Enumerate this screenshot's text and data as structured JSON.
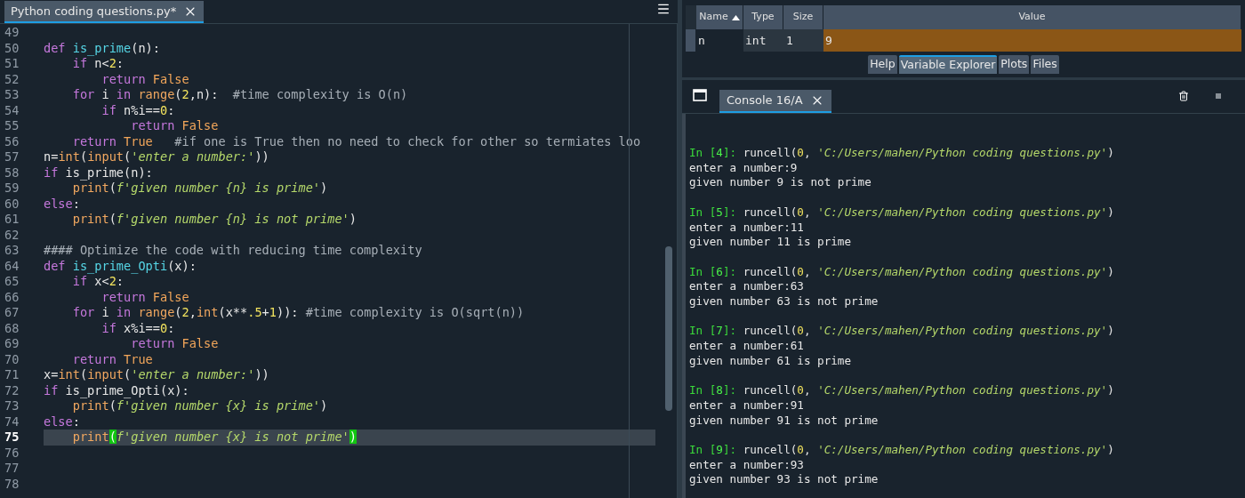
{
  "editor": {
    "tab": {
      "title": "Python coding questions.py*",
      "selected": true
    },
    "lines": [
      {
        "number": "49",
        "current": false
      },
      {
        "number": "50",
        "current": false,
        "tokens": [
          {
            "kind": "kw",
            "text": "def "
          },
          {
            "kind": "fn",
            "text": "is_prime"
          },
          {
            "kind": "txt",
            "text": "(n):"
          }
        ]
      },
      {
        "number": "51",
        "current": false,
        "tokens": [
          {
            "kind": "kw",
            "text": "    if"
          },
          {
            "kind": "txt",
            "text": " n<"
          },
          {
            "kind": "num",
            "text": "2"
          },
          {
            "kind": "txt",
            "text": ":"
          }
        ]
      },
      {
        "number": "52",
        "current": false,
        "tokens": [
          {
            "kind": "kw",
            "text": "        return "
          },
          {
            "kind": "const",
            "text": "False"
          }
        ]
      },
      {
        "number": "53",
        "current": false,
        "tokens": [
          {
            "kind": "kw",
            "text": "    for"
          },
          {
            "kind": "txt",
            "text": " i "
          },
          {
            "kind": "kw",
            "text": "in "
          },
          {
            "kind": "bi",
            "text": "range"
          },
          {
            "kind": "txt",
            "text": "("
          },
          {
            "kind": "num",
            "text": "2"
          },
          {
            "kind": "txt",
            "text": ",n):  "
          },
          {
            "kind": "cmt",
            "text": "#time complexity is O(n)"
          }
        ]
      },
      {
        "number": "54",
        "current": false,
        "tokens": [
          {
            "kind": "kw",
            "text": "        if"
          },
          {
            "kind": "txt",
            "text": " n%i=="
          },
          {
            "kind": "num",
            "text": "0"
          },
          {
            "kind": "txt",
            "text": ":"
          }
        ]
      },
      {
        "number": "55",
        "current": false,
        "tokens": [
          {
            "kind": "kw",
            "text": "            return "
          },
          {
            "kind": "const",
            "text": "False"
          }
        ]
      },
      {
        "number": "56",
        "current": false,
        "tokens": [
          {
            "kind": "kw",
            "text": "    return "
          },
          {
            "kind": "const",
            "text": "True   "
          },
          {
            "kind": "cmt",
            "text": "#if one is True then no need to check for other so termiates loo"
          }
        ]
      },
      {
        "number": "57",
        "current": false,
        "tokens": [
          {
            "kind": "txt",
            "text": "n="
          },
          {
            "kind": "bi",
            "text": "int"
          },
          {
            "kind": "txt",
            "text": "("
          },
          {
            "kind": "bi",
            "text": "input"
          },
          {
            "kind": "txt",
            "text": "("
          },
          {
            "kind": "str",
            "text": "'enter a number:'"
          },
          {
            "kind": "txt",
            "text": "))"
          }
        ]
      },
      {
        "number": "58",
        "current": false,
        "tokens": [
          {
            "kind": "kw",
            "text": "if"
          },
          {
            "kind": "txt",
            "text": " is_prime(n):"
          }
        ]
      },
      {
        "number": "59",
        "current": false,
        "tokens": [
          {
            "kind": "bi",
            "text": "    print"
          },
          {
            "kind": "txt",
            "text": "("
          },
          {
            "kind": "str",
            "text": "f'given number {n} is prime'"
          },
          {
            "kind": "txt",
            "text": ")"
          }
        ]
      },
      {
        "number": "60",
        "current": false,
        "tokens": [
          {
            "kind": "kw",
            "text": "else"
          },
          {
            "kind": "txt",
            "text": ":"
          }
        ]
      },
      {
        "number": "61",
        "current": false,
        "tokens": [
          {
            "kind": "bi",
            "text": "    print"
          },
          {
            "kind": "txt",
            "text": "("
          },
          {
            "kind": "str",
            "text": "f'given number {n} is not prime'"
          },
          {
            "kind": "txt",
            "text": ")"
          }
        ]
      },
      {
        "number": "62",
        "current": false
      },
      {
        "number": "63",
        "current": false,
        "tokens": [
          {
            "kind": "cmt",
            "text": "#### Optimize the code with reducing time complexity"
          }
        ]
      },
      {
        "number": "64",
        "current": false,
        "tokens": [
          {
            "kind": "kw",
            "text": "def "
          },
          {
            "kind": "fn",
            "text": "is_prime_Opti"
          },
          {
            "kind": "txt",
            "text": "(x):"
          }
        ]
      },
      {
        "number": "65",
        "current": false,
        "tokens": [
          {
            "kind": "kw",
            "text": "    if"
          },
          {
            "kind": "txt",
            "text": " x<"
          },
          {
            "kind": "num",
            "text": "2"
          },
          {
            "kind": "txt",
            "text": ":"
          }
        ]
      },
      {
        "number": "66",
        "current": false,
        "tokens": [
          {
            "kind": "kw",
            "text": "        return "
          },
          {
            "kind": "const",
            "text": "False"
          }
        ]
      },
      {
        "number": "67",
        "current": false,
        "tokens": [
          {
            "kind": "kw",
            "text": "    for"
          },
          {
            "kind": "txt",
            "text": " i "
          },
          {
            "kind": "kw",
            "text": "in "
          },
          {
            "kind": "bi",
            "text": "range"
          },
          {
            "kind": "txt",
            "text": "("
          },
          {
            "kind": "num",
            "text": "2"
          },
          {
            "kind": "txt",
            "text": ","
          },
          {
            "kind": "bi",
            "text": "int"
          },
          {
            "kind": "txt",
            "text": "(x**"
          },
          {
            "kind": "num",
            "text": ".5"
          },
          {
            "kind": "txt",
            "text": "+"
          },
          {
            "kind": "num",
            "text": "1"
          },
          {
            "kind": "txt",
            "text": ")): "
          },
          {
            "kind": "cmt",
            "text": "#time complexity is O(sqrt(n))"
          }
        ]
      },
      {
        "number": "68",
        "current": false,
        "tokens": [
          {
            "kind": "kw",
            "text": "        if"
          },
          {
            "kind": "txt",
            "text": " x%i=="
          },
          {
            "kind": "num",
            "text": "0"
          },
          {
            "kind": "txt",
            "text": ":"
          }
        ]
      },
      {
        "number": "69",
        "current": false,
        "tokens": [
          {
            "kind": "kw",
            "text": "            return "
          },
          {
            "kind": "const",
            "text": "False"
          }
        ]
      },
      {
        "number": "70",
        "current": false,
        "tokens": [
          {
            "kind": "kw",
            "text": "    return "
          },
          {
            "kind": "const",
            "text": "True"
          }
        ]
      },
      {
        "number": "71",
        "current": false,
        "tokens": [
          {
            "kind": "txt",
            "text": "x="
          },
          {
            "kind": "bi",
            "text": "int"
          },
          {
            "kind": "txt",
            "text": "("
          },
          {
            "kind": "bi",
            "text": "input"
          },
          {
            "kind": "txt",
            "text": "("
          },
          {
            "kind": "str",
            "text": "'enter a number:'"
          },
          {
            "kind": "txt",
            "text": "))"
          }
        ]
      },
      {
        "number": "72",
        "current": false,
        "tokens": [
          {
            "kind": "kw",
            "text": "if"
          },
          {
            "kind": "txt",
            "text": " is_prime_Opti(x):"
          }
        ]
      },
      {
        "number": "73",
        "current": false,
        "tokens": [
          {
            "kind": "bi",
            "text": "    print"
          },
          {
            "kind": "txt",
            "text": "("
          },
          {
            "kind": "str",
            "text": "f'given number {x} is prime'"
          },
          {
            "kind": "txt",
            "text": ")"
          }
        ]
      },
      {
        "number": "74",
        "current": false,
        "tokens": [
          {
            "kind": "kw",
            "text": "else"
          },
          {
            "kind": "txt",
            "text": ":"
          }
        ]
      },
      {
        "number": "75",
        "current": true,
        "tokens": [
          {
            "kind": "bi",
            "text": "    print"
          },
          {
            "kind": "match",
            "text": "("
          },
          {
            "kind": "str",
            "text": "f'given number {x} is not prime'"
          },
          {
            "kind": "match",
            "text": ")"
          }
        ]
      },
      {
        "number": "76",
        "current": false
      },
      {
        "number": "77",
        "current": false
      },
      {
        "number": "78",
        "current": false
      }
    ]
  },
  "variable_explorer": {
    "columns": [
      {
        "label": "Name",
        "sorted": true
      },
      {
        "label": "Type",
        "sorted": false
      },
      {
        "label": "Size",
        "sorted": false
      },
      {
        "label": "Value",
        "sorted": false
      }
    ],
    "rows": [
      {
        "name": "n",
        "type": "int",
        "size": "1",
        "value": "9",
        "color": "#8b5616"
      }
    ]
  },
  "pane_tabs": [
    {
      "label": "Help",
      "selected": false
    },
    {
      "label": "Variable Explorer",
      "selected": true
    },
    {
      "label": "Plots",
      "selected": false
    },
    {
      "label": "Files",
      "selected": false
    }
  ],
  "console": {
    "tab": {
      "title": "Console 16/A",
      "selected": true
    },
    "entries": [
      {
        "input": [
          {
            "kind": "prompt",
            "text": "In ["
          },
          {
            "kind": "pnum",
            "text": "4"
          },
          {
            "kind": "prompt",
            "text": "]: "
          },
          {
            "kind": "txt",
            "text": "runcell("
          },
          {
            "kind": "num",
            "text": "0"
          },
          {
            "kind": "txt",
            "text": ", "
          },
          {
            "kind": "str",
            "text": "'C:/Users/mahen/Python coding questions.py'"
          },
          {
            "kind": "txt",
            "text": ")"
          }
        ],
        "output": [
          "enter a number:9",
          "given number 9 is not prime"
        ]
      },
      {
        "input": [
          {
            "kind": "prompt",
            "text": "In ["
          },
          {
            "kind": "pnum",
            "text": "5"
          },
          {
            "kind": "prompt",
            "text": "]: "
          },
          {
            "kind": "txt",
            "text": "runcell("
          },
          {
            "kind": "num",
            "text": "0"
          },
          {
            "kind": "txt",
            "text": ", "
          },
          {
            "kind": "str",
            "text": "'C:/Users/mahen/Python coding questions.py'"
          },
          {
            "kind": "txt",
            "text": ")"
          }
        ],
        "output": [
          "enter a number:11",
          "given number 11 is prime"
        ]
      },
      {
        "input": [
          {
            "kind": "prompt",
            "text": "In ["
          },
          {
            "kind": "pnum",
            "text": "6"
          },
          {
            "kind": "prompt",
            "text": "]: "
          },
          {
            "kind": "txt",
            "text": "runcell("
          },
          {
            "kind": "num",
            "text": "0"
          },
          {
            "kind": "txt",
            "text": ", "
          },
          {
            "kind": "str",
            "text": "'C:/Users/mahen/Python coding questions.py'"
          },
          {
            "kind": "txt",
            "text": ")"
          }
        ],
        "output": [
          "enter a number:63",
          "given number 63 is not prime"
        ]
      },
      {
        "input": [
          {
            "kind": "prompt",
            "text": "In ["
          },
          {
            "kind": "pnum",
            "text": "7"
          },
          {
            "kind": "prompt",
            "text": "]: "
          },
          {
            "kind": "txt",
            "text": "runcell("
          },
          {
            "kind": "num",
            "text": "0"
          },
          {
            "kind": "txt",
            "text": ", "
          },
          {
            "kind": "str",
            "text": "'C:/Users/mahen/Python coding questions.py'"
          },
          {
            "kind": "txt",
            "text": ")"
          }
        ],
        "output": [
          "enter a number:61",
          "given number 61 is prime"
        ]
      },
      {
        "input": [
          {
            "kind": "prompt",
            "text": "In ["
          },
          {
            "kind": "pnum",
            "text": "8"
          },
          {
            "kind": "prompt",
            "text": "]: "
          },
          {
            "kind": "txt",
            "text": "runcell("
          },
          {
            "kind": "num",
            "text": "0"
          },
          {
            "kind": "txt",
            "text": ", "
          },
          {
            "kind": "str",
            "text": "'C:/Users/mahen/Python coding questions.py'"
          },
          {
            "kind": "txt",
            "text": ")"
          }
        ],
        "output": [
          "enter a number:91",
          "given number 91 is not prime"
        ]
      },
      {
        "input": [
          {
            "kind": "prompt",
            "text": "In ["
          },
          {
            "kind": "pnum",
            "text": "9"
          },
          {
            "kind": "prompt",
            "text": "]: "
          },
          {
            "kind": "txt",
            "text": "runcell("
          },
          {
            "kind": "num",
            "text": "0"
          },
          {
            "kind": "txt",
            "text": ", "
          },
          {
            "kind": "str",
            "text": "'C:/Users/mahen/Python coding questions.py'"
          },
          {
            "kind": "txt",
            "text": ")"
          }
        ],
        "output": [
          "enter a number:93",
          "given number 93 is not prime"
        ]
      }
    ]
  }
}
